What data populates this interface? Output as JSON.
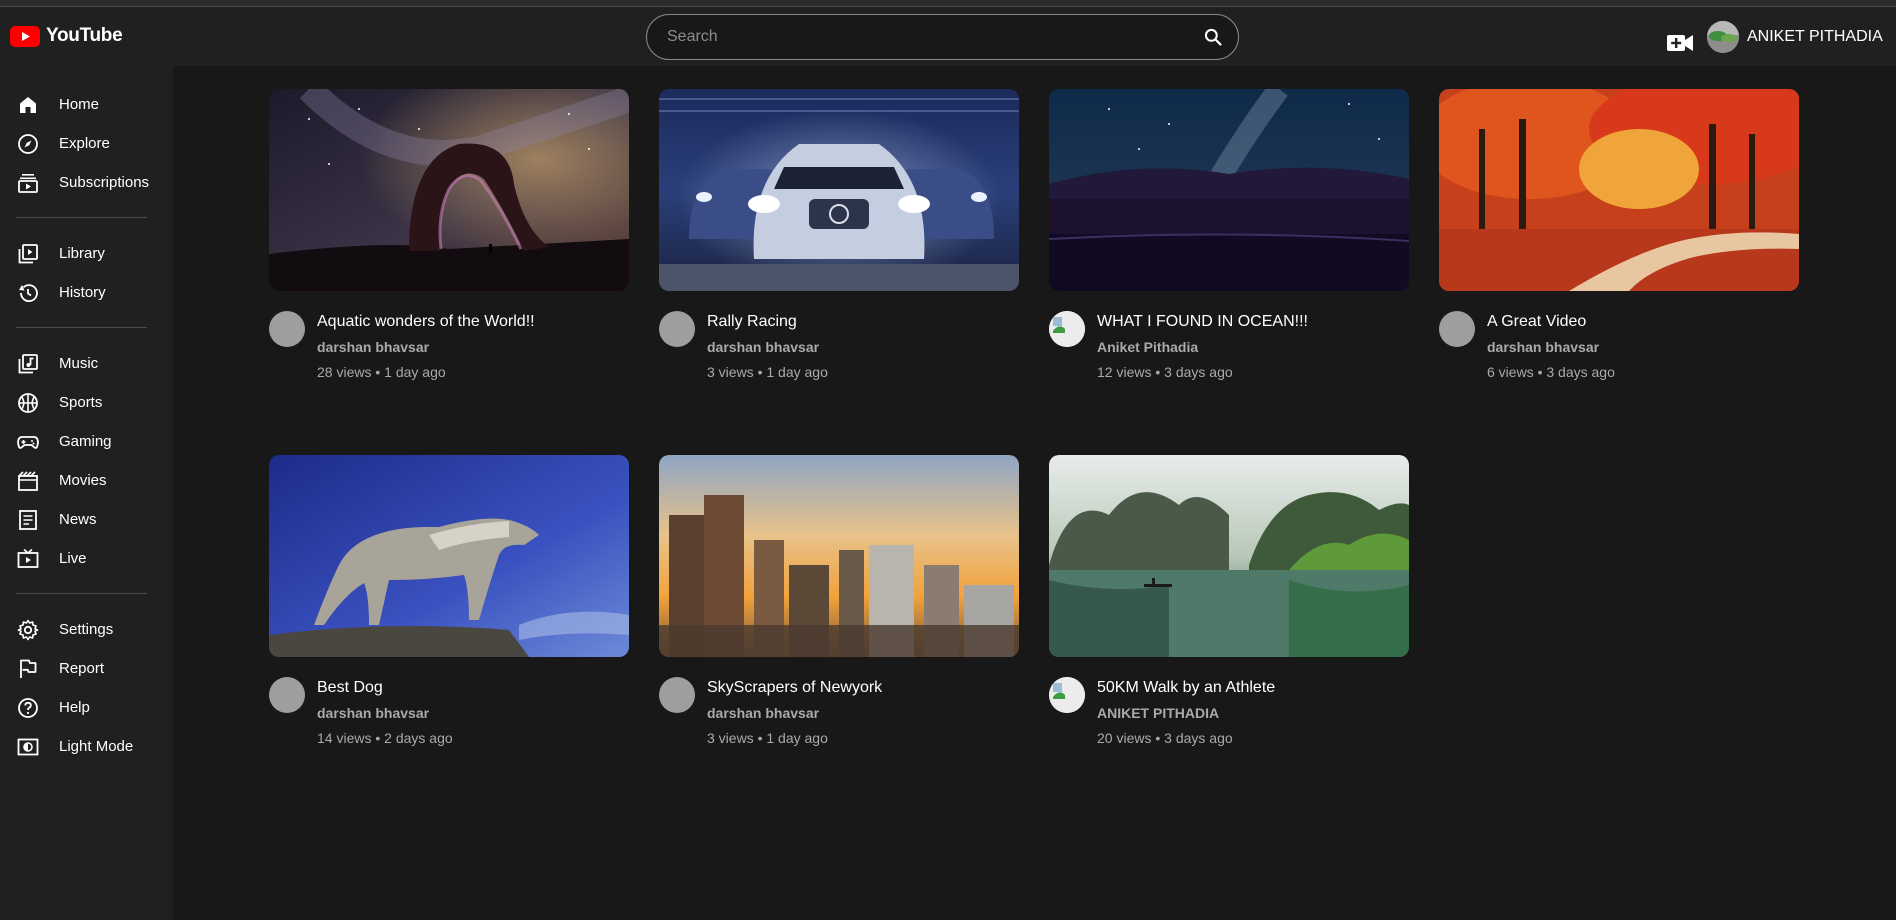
{
  "header": {
    "logo_text": "YouTube",
    "search_placeholder": "Search",
    "account_name": "ANIKET PITHADIA"
  },
  "sidebar": {
    "items": [
      {
        "label": "Home",
        "icon": "home-icon"
      },
      {
        "label": "Explore",
        "icon": "compass-icon"
      },
      {
        "label": "Subscriptions",
        "icon": "subscriptions-icon"
      },
      {
        "label": "Library",
        "icon": "library-icon"
      },
      {
        "label": "History",
        "icon": "history-icon"
      },
      {
        "label": "Music",
        "icon": "music-icon"
      },
      {
        "label": "Sports",
        "icon": "sports-icon"
      },
      {
        "label": "Gaming",
        "icon": "gamepad-icon"
      },
      {
        "label": "Movies",
        "icon": "film-icon"
      },
      {
        "label": "News",
        "icon": "news-icon"
      },
      {
        "label": "Live",
        "icon": "live-tv-icon"
      },
      {
        "label": "Settings",
        "icon": "gear-icon"
      },
      {
        "label": "Report",
        "icon": "flag-icon"
      },
      {
        "label": "Help",
        "icon": "help-icon"
      },
      {
        "label": "Light Mode",
        "icon": "light-mode-icon"
      }
    ]
  },
  "videos": [
    {
      "title": "Aquatic wonders of the World!!",
      "channel": "darshan bhavsar",
      "stats": "28 views • 1 day ago",
      "thumbnail": "night-sky-arch"
    },
    {
      "title": "Rally Racing",
      "channel": "darshan bhavsar",
      "stats": "3 views • 1 day ago",
      "thumbnail": "cars-headlights"
    },
    {
      "title": "WHAT I FOUND IN OCEAN!!!",
      "channel": "Aniket Pithadia",
      "stats": "12 views • 3 days ago",
      "thumbnail": "milky-way-lake"
    },
    {
      "title": "A Great Video",
      "channel": "darshan bhavsar",
      "stats": "6 views • 3 days ago",
      "thumbnail": "autumn-forest"
    },
    {
      "title": "Best Dog",
      "channel": "darshan bhavsar",
      "stats": "14 views • 2 days ago",
      "thumbnail": "wolf-on-rock"
    },
    {
      "title": "SkyScrapers of Newyork",
      "channel": "darshan bhavsar",
      "stats": "3 views • 1 day ago",
      "thumbnail": "city-skyline-sunset"
    },
    {
      "title": "50KM Walk by an Athlete",
      "channel": "ANIKET PITHADIA",
      "stats": "20 views • 3 days ago",
      "thumbnail": "misty-lake-boat"
    }
  ],
  "colors": {
    "brand_red": "#ff0000",
    "header_bg": "#202020",
    "page_bg": "#181818",
    "secondary_text": "#aaaaaa"
  }
}
